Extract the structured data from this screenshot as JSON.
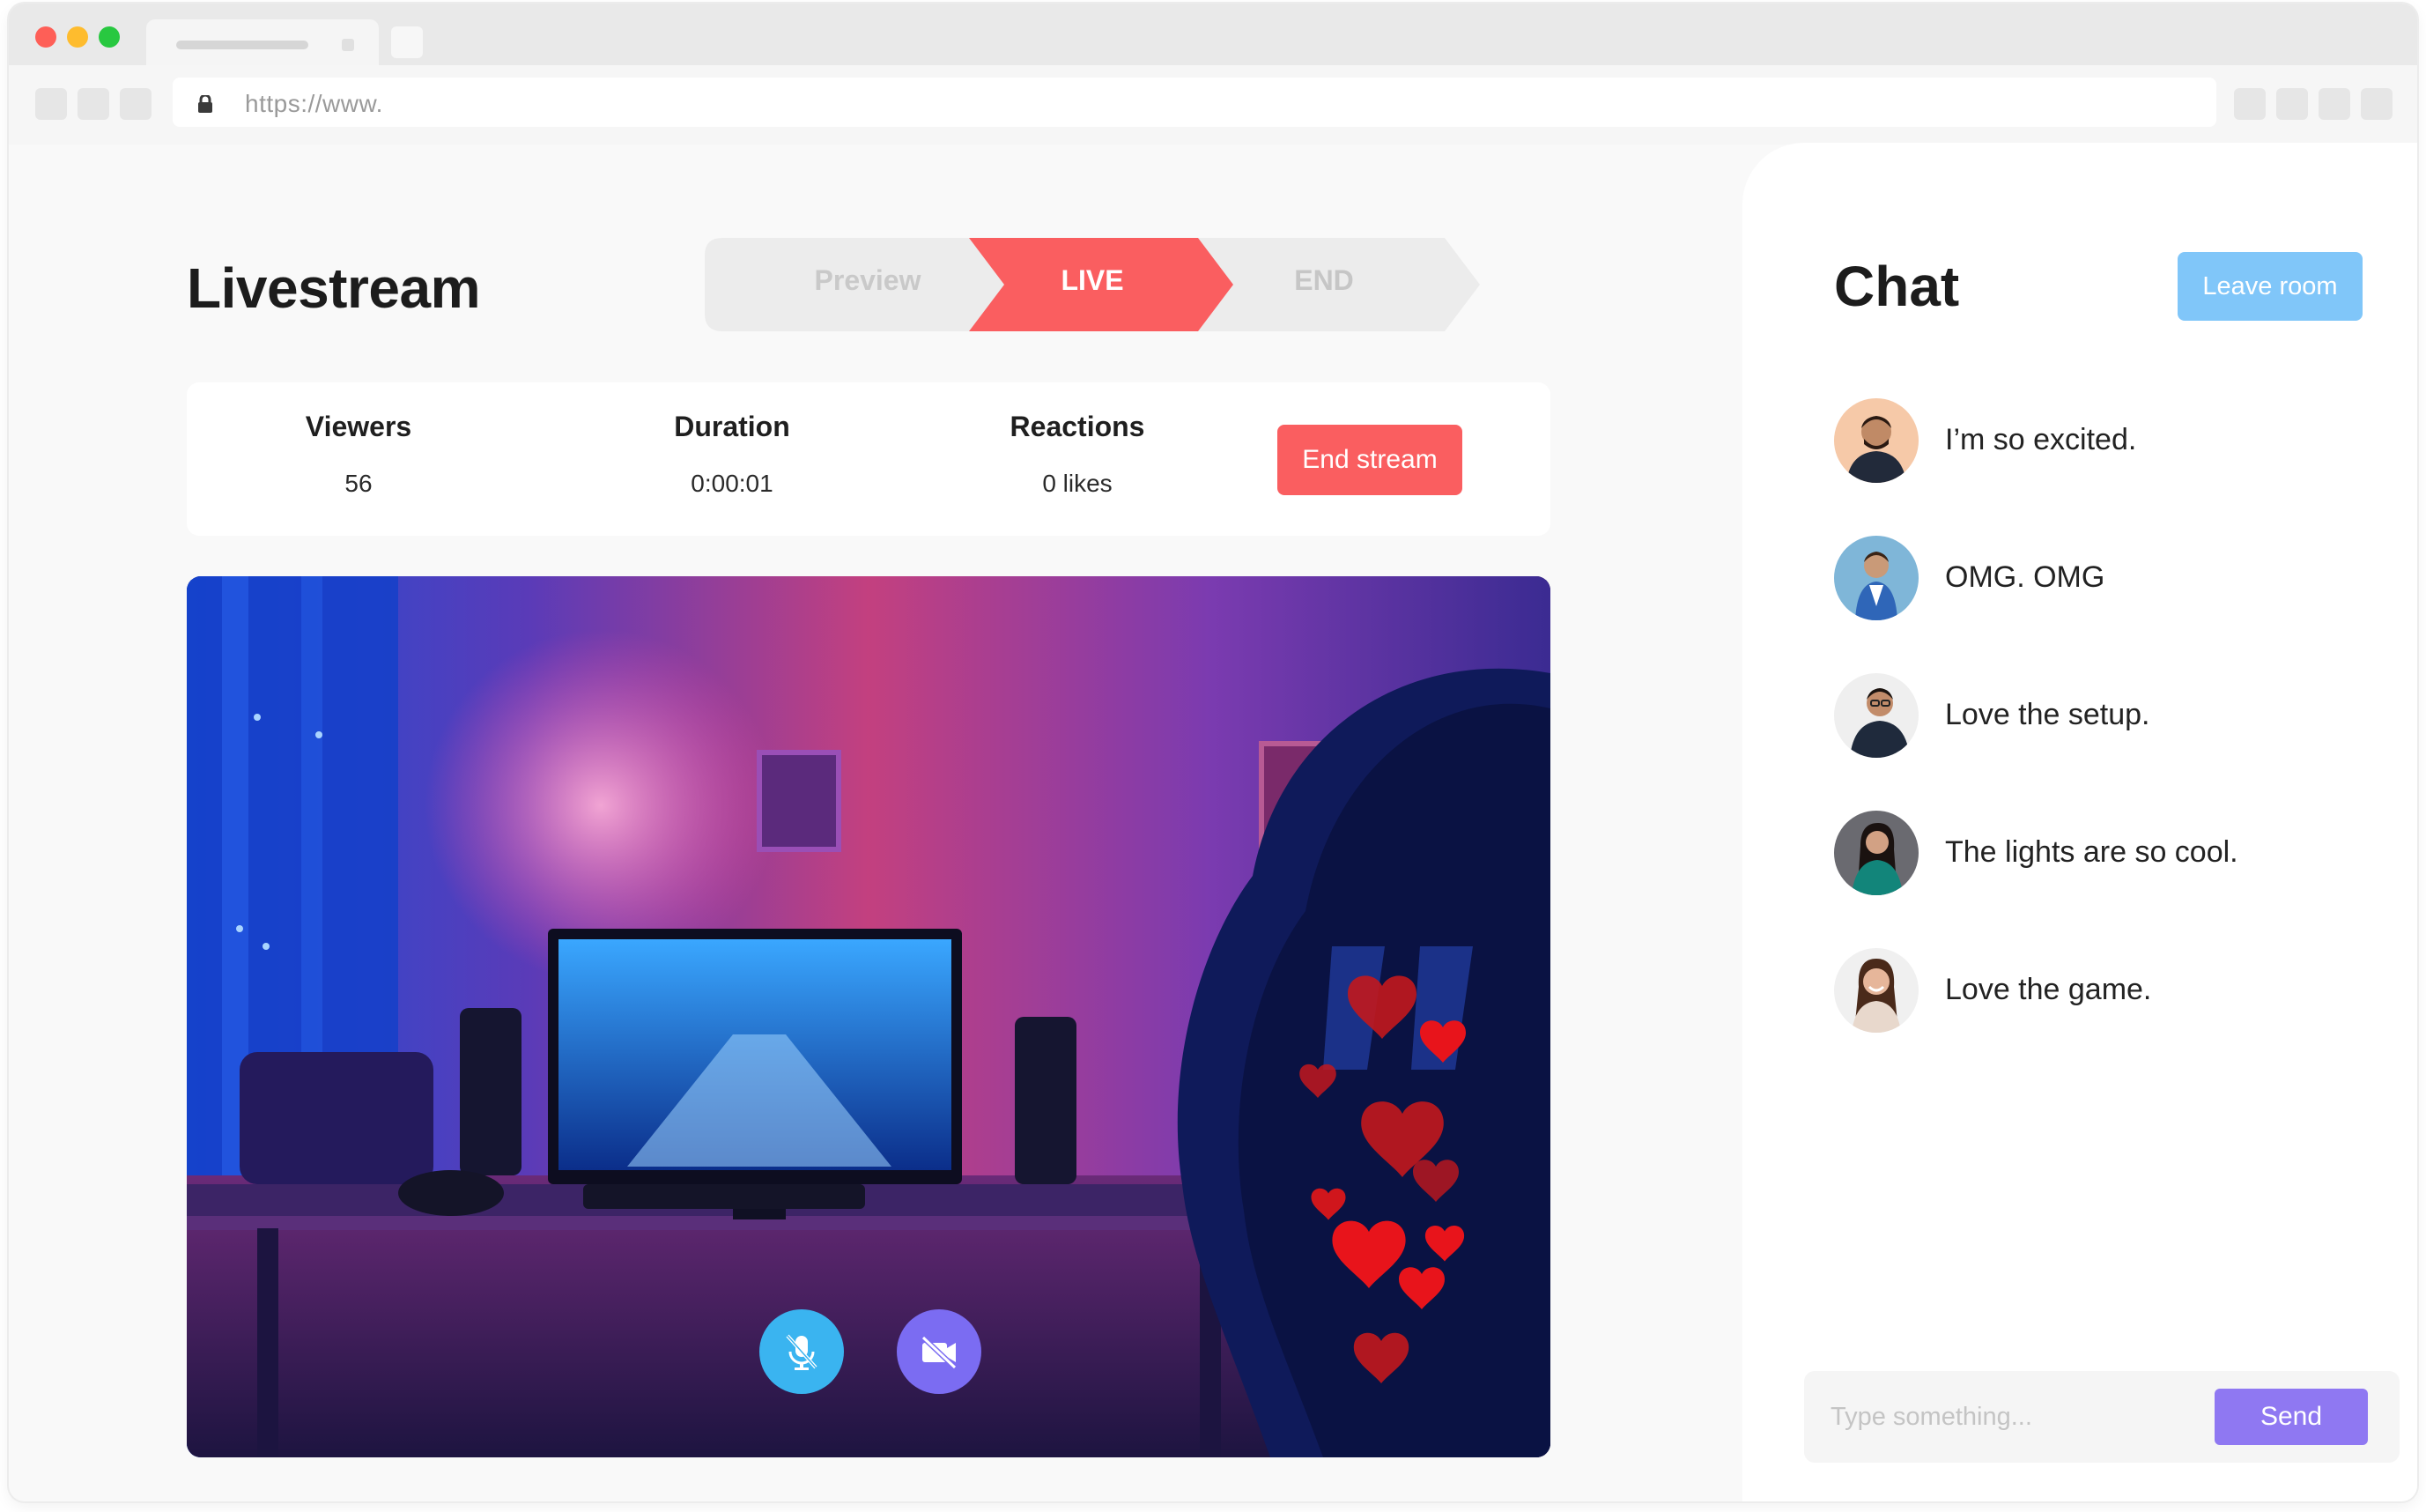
{
  "browser": {
    "url": "https://www."
  },
  "page": {
    "title": "Livestream"
  },
  "stepper": {
    "steps": [
      "Preview",
      "LIVE",
      "END"
    ],
    "active_step": "LIVE",
    "active_color": "#fa5e60"
  },
  "stats": {
    "viewers_label": "Viewers",
    "viewers_value": "56",
    "duration_label": "Duration",
    "duration_value": "0:00:01",
    "reactions_label": "Reactions",
    "reactions_value": "0 likes"
  },
  "actions": {
    "end_stream_label": "End stream",
    "end_stream_color": "#fa5e60"
  },
  "video": {
    "controls": [
      {
        "icon": "mic-off-icon",
        "color": "#3ab4f0"
      },
      {
        "icon": "camera-off-icon",
        "color": "#7b6cf2"
      }
    ],
    "reaction_icon": "heart-icon",
    "reaction_color": "#e8141b"
  },
  "chat": {
    "title": "Chat",
    "leave_label": "Leave room",
    "leave_color": "#80c6f9",
    "messages": [
      {
        "text": "I’m so excited.",
        "avatar_icon": "avatar-man-beard"
      },
      {
        "text": "OMG. OMG",
        "avatar_icon": "avatar-man-blue-shirt"
      },
      {
        "text": "Love the setup.",
        "avatar_icon": "avatar-man-glasses"
      },
      {
        "text": "The lights are so cool.",
        "avatar_icon": "avatar-woman-teal"
      },
      {
        "text": "Love the game.",
        "avatar_icon": "avatar-woman-smile"
      }
    ],
    "input_placeholder": "Type something...",
    "send_label": "Send",
    "send_color": "#8f78f2"
  }
}
